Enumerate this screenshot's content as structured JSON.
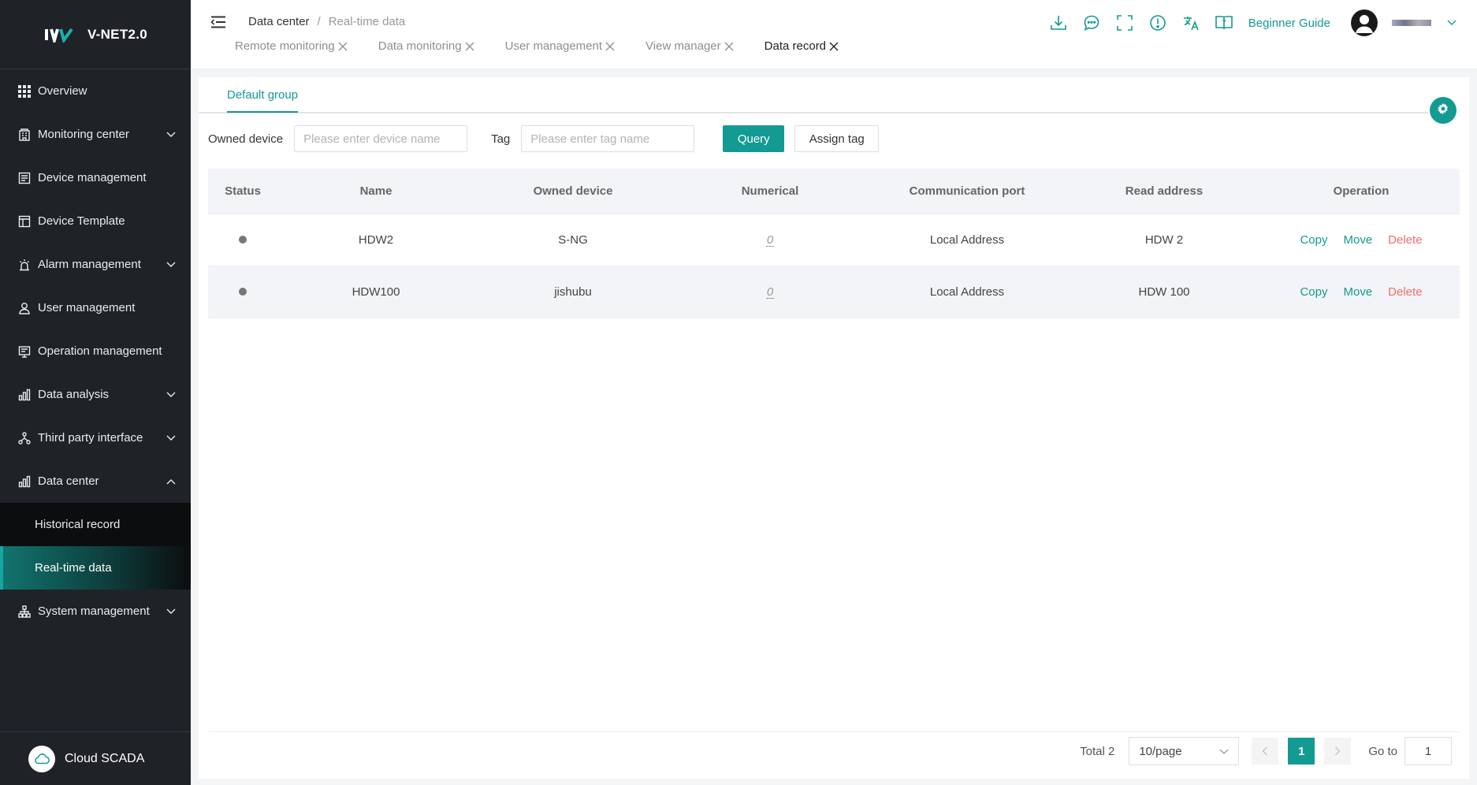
{
  "app": {
    "name": "V-NET2.0",
    "footer_label": "Cloud SCADA"
  },
  "sidebar": {
    "items": [
      {
        "label": "Overview",
        "icon": "grid-icon",
        "expandable": false
      },
      {
        "label": "Monitoring center",
        "icon": "building-icon",
        "expandable": true
      },
      {
        "label": "Device management",
        "icon": "device-list-icon",
        "expandable": false
      },
      {
        "label": "Device Template",
        "icon": "template-icon",
        "expandable": false
      },
      {
        "label": "Alarm management",
        "icon": "alarm-light-icon",
        "expandable": true
      },
      {
        "label": "User management",
        "icon": "user-icon",
        "expandable": false
      },
      {
        "label": "Operation management",
        "icon": "monitor-icon",
        "expandable": false
      },
      {
        "label": "Data analysis",
        "icon": "bar-chart-icon",
        "expandable": true
      },
      {
        "label": "Third party interface",
        "icon": "network-icon",
        "expandable": true
      },
      {
        "label": "Data center",
        "icon": "bar-chart-icon",
        "expandable": true,
        "expanded": true
      },
      {
        "label": "Historical record",
        "sub": true
      },
      {
        "label": "Real-time data",
        "sub": true,
        "active": true
      },
      {
        "label": "System management",
        "icon": "org-chart-icon",
        "expandable": true
      }
    ]
  },
  "header": {
    "breadcrumb": {
      "parent": "Data center",
      "separator": "/",
      "current": "Real-time data"
    },
    "tabs": [
      {
        "label": "Remote monitoring",
        "active": false
      },
      {
        "label": "Data monitoring",
        "active": false
      },
      {
        "label": "User management",
        "active": false
      },
      {
        "label": "View manager",
        "active": false
      },
      {
        "label": "Data record",
        "active": true
      }
    ],
    "icons": [
      "download-icon",
      "chat-icon",
      "fullscreen-icon",
      "alert-icon",
      "translate-icon",
      "help-book-icon"
    ],
    "guide_label": "Beginner Guide"
  },
  "content": {
    "group_tab": "Default group",
    "filters": {
      "device_label": "Owned device",
      "device_placeholder": "Please enter device name",
      "tag_label": "Tag",
      "tag_placeholder": "Please enter tag name",
      "query_label": "Query",
      "assign_label": "Assign tag"
    },
    "table": {
      "columns": [
        "Status",
        "Name",
        "Owned device",
        "Numerical",
        "Communication port",
        "Read address",
        "Operation"
      ],
      "rows": [
        {
          "name": "HDW2",
          "device": "S-NG",
          "numerical": "0",
          "port": "Local Address",
          "address": "HDW 2"
        },
        {
          "name": "HDW100",
          "device": "jishubu",
          "numerical": "0",
          "port": "Local Address",
          "address": "HDW 100"
        }
      ],
      "ops": {
        "copy": "Copy",
        "move": "Move",
        "delete": "Delete"
      }
    },
    "pagination": {
      "total": "Total 2",
      "page_size": "10/page",
      "current": "1",
      "goto_label": "Go to",
      "goto_value": "1"
    }
  },
  "colors": {
    "accent": "#139a93",
    "sidebar_bg": "#1f2328",
    "danger": "#f56c6c"
  }
}
